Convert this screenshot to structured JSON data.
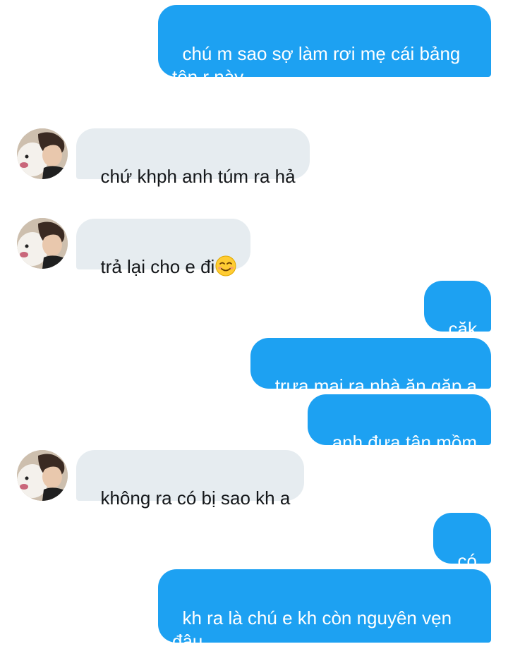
{
  "conversation": {
    "messages": [
      {
        "id": "m1",
        "side": "sent",
        "text": "chú m sao sợ làm rơi mẹ cái bảng\ntên r này"
      },
      {
        "id": "m2",
        "side": "received",
        "text": "chứ khph anh túm ra hả"
      },
      {
        "id": "m3",
        "side": "received",
        "text": "trả lại cho e đi",
        "emoji": "smiling-face-icon"
      },
      {
        "id": "m4",
        "side": "sent",
        "text": "căk"
      },
      {
        "id": "m5",
        "side": "sent",
        "text": "trưa mai ra nhà ăn gặp a"
      },
      {
        "id": "m6",
        "side": "sent",
        "text": "anh đưa tận mồm"
      },
      {
        "id": "m7",
        "side": "received",
        "text": "không ra có bị sao kh a"
      },
      {
        "id": "m8",
        "side": "sent",
        "text": "có"
      },
      {
        "id": "m9",
        "side": "sent",
        "text": "kh ra là chú e kh còn nguyên vẹn\nđâu"
      }
    ]
  },
  "colors": {
    "sent_bubble": "#1da1f2",
    "sent_text": "#ffffff",
    "received_bubble": "#e6ecf0",
    "received_text": "#14171a"
  }
}
